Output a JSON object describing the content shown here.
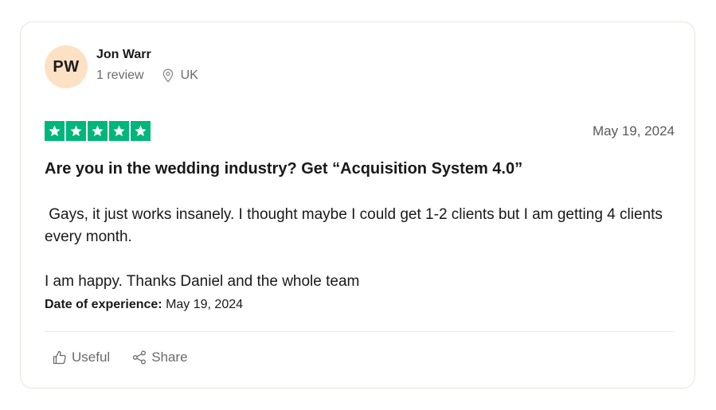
{
  "reviewer": {
    "initials": "PW",
    "name": "Jon Warr",
    "review_count": "1 review",
    "location": "UK"
  },
  "review": {
    "rating": 5,
    "rating_color": "#00b67a",
    "date": "May 19, 2024",
    "title": "Are you in the wedding industry? Get “Acquisition System 4.0”",
    "paragraph_1": "Gays, it just works insanely. I thought maybe I could get 1-2 clients but I am getting 4 clients every month.",
    "paragraph_2": "I am happy. Thanks Daniel and the whole team",
    "experience_label": "Date of experience:",
    "experience_date": "May 19, 2024"
  },
  "actions": {
    "useful_label": "Useful",
    "share_label": "Share",
    "useful_icon": "thumbs-up-icon",
    "share_icon": "share-icon"
  }
}
